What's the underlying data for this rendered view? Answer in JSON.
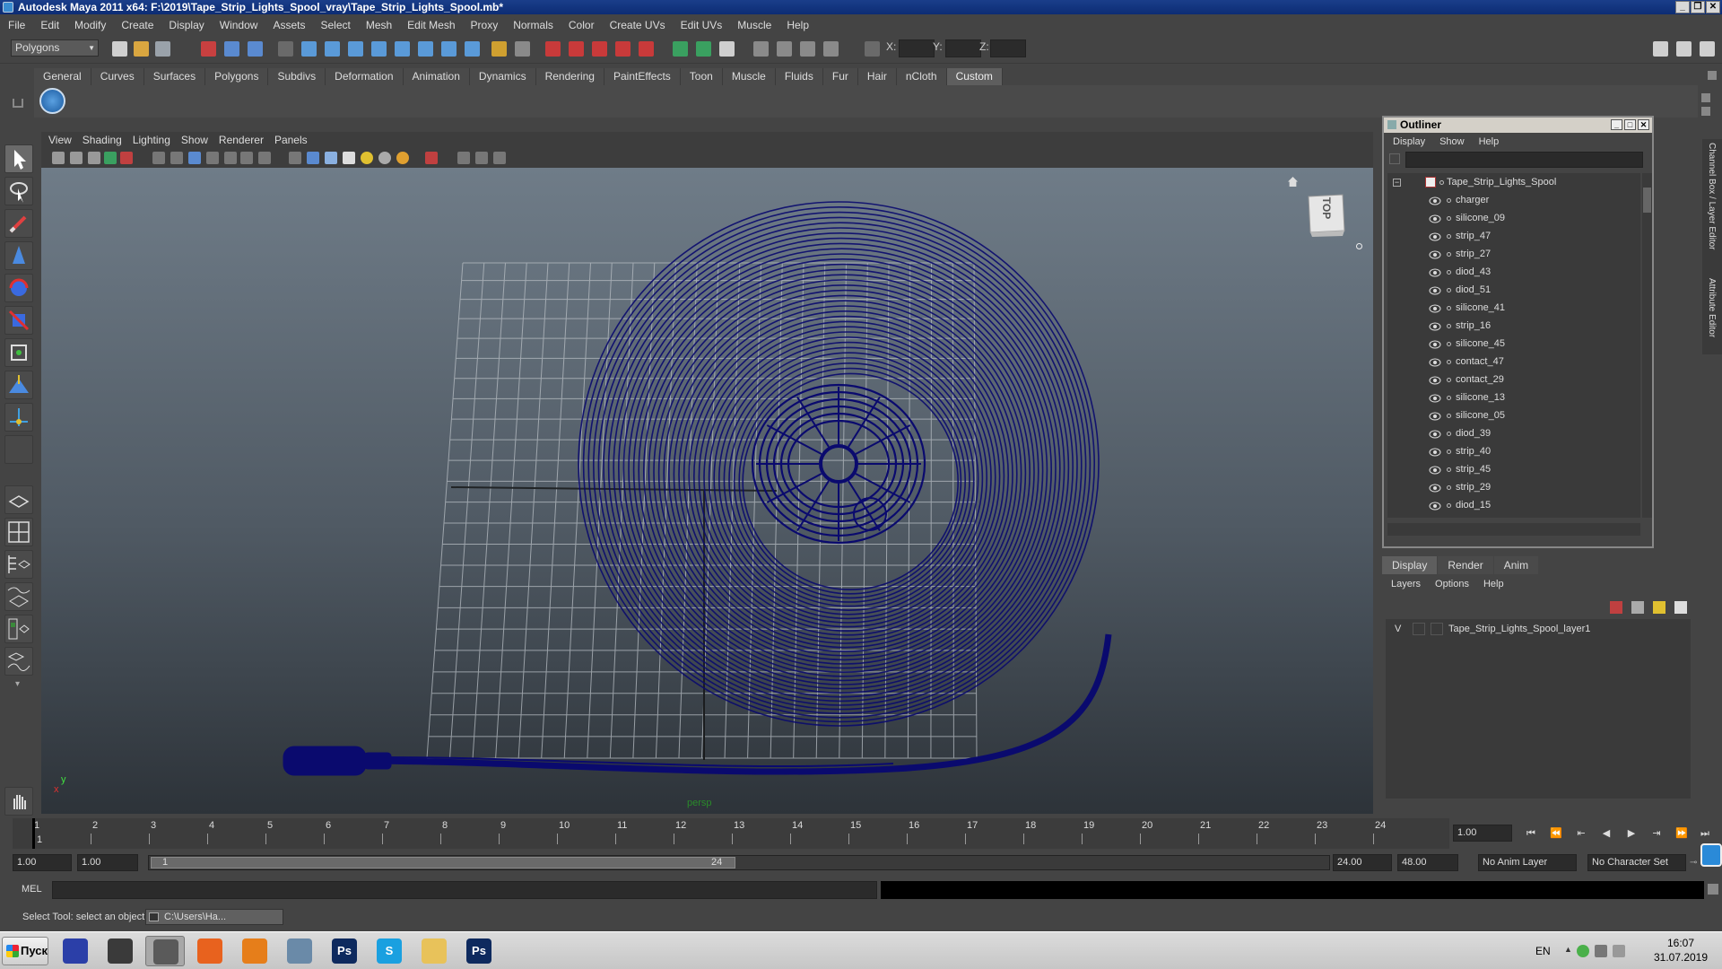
{
  "window": {
    "title": "Autodesk Maya 2011 x64: F:\\2019\\Tape_Strip_Lights_Spool_vray\\Tape_Strip_Lights_Spool.mb*"
  },
  "menubar": [
    "File",
    "Edit",
    "Modify",
    "Create",
    "Display",
    "Window",
    "Assets",
    "Select",
    "Mesh",
    "Edit Mesh",
    "Proxy",
    "Normals",
    "Color",
    "Create UVs",
    "Edit UVs",
    "Muscle",
    "Help"
  ],
  "statusline": {
    "mode": "Polygons",
    "x_label": "X:",
    "y_label": "Y:",
    "z_label": "Z:"
  },
  "shelf": {
    "tabs": [
      "General",
      "Curves",
      "Surfaces",
      "Polygons",
      "Subdivs",
      "Deformation",
      "Animation",
      "Dynamics",
      "Rendering",
      "PaintEffects",
      "Toon",
      "Muscle",
      "Fluids",
      "Fur",
      "Hair",
      "nCloth",
      "Custom"
    ],
    "active": "Custom"
  },
  "viewport": {
    "menu": [
      "View",
      "Shading",
      "Lighting",
      "Show",
      "Renderer",
      "Panels"
    ],
    "camera_label": "persp",
    "viewcube_label": "TOP",
    "axis_x": "x",
    "axis_y": "y",
    "wire_color": "#0a0a6e"
  },
  "outliner": {
    "title": "Outliner",
    "menu": [
      "Display",
      "Show",
      "Help"
    ],
    "root": "Tape_Strip_Lights_Spool",
    "items": [
      "charger",
      "silicone_09",
      "strip_47",
      "strip_27",
      "diod_43",
      "diod_51",
      "silicone_41",
      "strip_16",
      "silicone_45",
      "contact_47",
      "contact_29",
      "silicone_13",
      "silicone_05",
      "diod_39",
      "strip_40",
      "strip_45",
      "strip_29",
      "diod_15"
    ]
  },
  "layer_editor": {
    "tabs": [
      "Display",
      "Render",
      "Anim"
    ],
    "active_tab": "Display",
    "menu": [
      "Layers",
      "Options",
      "Help"
    ],
    "layers": [
      {
        "visible": "V",
        "name": "Tape_Strip_Lights_Spool_layer1"
      }
    ]
  },
  "side_tabs": [
    "Channel Box / Layer Editor",
    "Attribute Editor"
  ],
  "timeslider": {
    "ticks": [
      "1",
      "2",
      "3",
      "4",
      "5",
      "6",
      "7",
      "8",
      "9",
      "10",
      "11",
      "12",
      "13",
      "14",
      "15",
      "16",
      "17",
      "18",
      "19",
      "20",
      "21",
      "22",
      "23",
      "24"
    ],
    "current_frame_marker": "1",
    "current_time": "1.00"
  },
  "range": {
    "start": "1.00",
    "playback_start": "1.00",
    "slider_start": "1",
    "slider_end": "24",
    "playback_end": "24.00",
    "end": "48.00",
    "anim_layer": "No Anim Layer",
    "char_set": "No Character Set"
  },
  "cmdline": {
    "label": "MEL"
  },
  "helpline": {
    "text": "Select Tool: select an object",
    "minimized_window": "C:\\Users\\Ha..."
  },
  "taskbar": {
    "start": "Пуск",
    "lang": "EN",
    "time": "16:07",
    "date": "31.07.2019",
    "apps": [
      {
        "name": "save-app",
        "label": "",
        "color": "#2b3fa8"
      },
      {
        "name": "cinema-app",
        "label": "",
        "color": "#3a3a3a"
      },
      {
        "name": "maya-app",
        "label": "",
        "color": "#5a5a5a"
      },
      {
        "name": "firefox-app",
        "label": "",
        "color": "#e8621e"
      },
      {
        "name": "blender-app",
        "label": "",
        "color": "#e67e1a"
      },
      {
        "name": "tool-app",
        "label": "",
        "color": "#6a8aa8"
      },
      {
        "name": "photoshop-app",
        "label": "Ps",
        "color": "#0e2a5e"
      },
      {
        "name": "skype-app",
        "label": "S",
        "color": "#1aa0e0"
      },
      {
        "name": "explorer-app",
        "label": "",
        "color": "#e8c25a"
      },
      {
        "name": "photoshop2-app",
        "label": "Ps",
        "color": "#0e2a5e"
      }
    ]
  }
}
